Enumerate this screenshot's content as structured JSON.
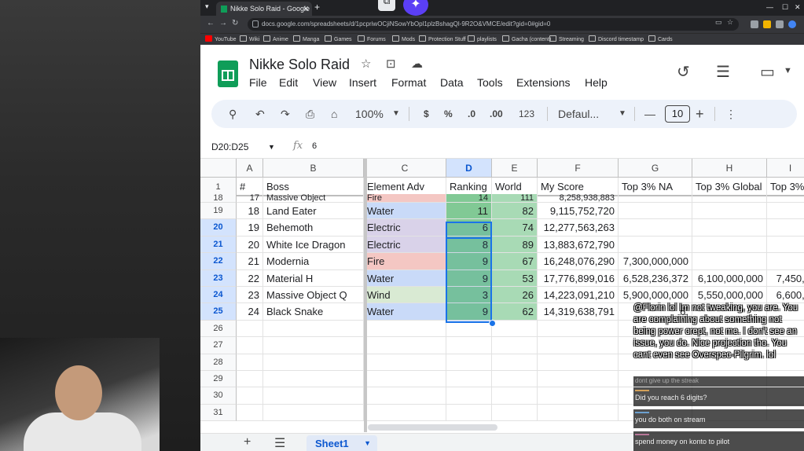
{
  "browser": {
    "tab_title": "Nikke Solo Raid - Google Sheets",
    "url": "docs.google.com/spreadsheets/d/1pcpriwOCjiNSowYbOpl1plzBshagQl-9R2O&VMCE/edit?gid=0#gid=0",
    "bookmarks": [
      "YouTube",
      "Wiki",
      "Anime",
      "Manga",
      "Games",
      "Forums",
      "Mods",
      "Protection Stuff",
      "playlists",
      "Gacha (content)",
      "Streaming",
      "Discord timestamp",
      "Cards"
    ]
  },
  "sheets": {
    "title": "Nikke Solo Raid",
    "menu": [
      "File",
      "Edit",
      "View",
      "Insert",
      "Format",
      "Data",
      "Tools",
      "Extensions",
      "Help"
    ],
    "toolbar": {
      "zoom": "100%",
      "currency": "$",
      "percent": "%",
      "dec_decrease": ".0",
      "dec_increase": ".00",
      "number_format": "123",
      "font": "Defaul...",
      "font_size": "10",
      "minus": "—",
      "plus": "+",
      "more": "⋮"
    },
    "name_box": "D20:D25",
    "fx": "fx",
    "formula_value": "6",
    "columns": [
      "A",
      "B",
      "C",
      "D",
      "E",
      "F",
      "G",
      "H",
      "I"
    ],
    "header_row": {
      "row": "1",
      "cells": [
        "#",
        "Boss",
        "Element Adv",
        "Ranking",
        "World",
        "My Score",
        "Top 3% NA",
        "Top 3% Global",
        "Top 3%"
      ]
    },
    "rows": [
      {
        "row": "18",
        "num": "17",
        "boss": "Massive Object",
        "element": "Fire",
        "ranking": "14",
        "world": "111",
        "score": "8,258,938,883",
        "na": "",
        "global": "",
        "top": ""
      },
      {
        "row": "19",
        "num": "18",
        "boss": "Land Eater",
        "element": "Water",
        "ranking": "11",
        "world": "82",
        "score": "9,115,752,720",
        "na": "",
        "global": "",
        "top": ""
      },
      {
        "row": "20",
        "num": "19",
        "boss": "Behemoth",
        "element": "Electric",
        "ranking": "6",
        "world": "74",
        "score": "12,277,563,263",
        "na": "",
        "global": "",
        "top": ""
      },
      {
        "row": "21",
        "num": "20",
        "boss": "White Ice Dragon",
        "element": "Electric",
        "ranking": "8",
        "world": "89",
        "score": "13,883,672,790",
        "na": "",
        "global": "",
        "top": ""
      },
      {
        "row": "22",
        "num": "21",
        "boss": "Modernia",
        "element": "Fire",
        "ranking": "9",
        "world": "67",
        "score": "16,248,076,290",
        "na": "7,300,000,000",
        "global": "",
        "top": ""
      },
      {
        "row": "23",
        "num": "22",
        "boss": "Material H",
        "element": "Water",
        "ranking": "9",
        "world": "53",
        "score": "17,776,899,016",
        "na": "6,528,236,372",
        "global": "6,100,000,000",
        "top": "7,450,0"
      },
      {
        "row": "24",
        "num": "23",
        "boss": "Massive Object Q",
        "element": "Wind",
        "ranking": "3",
        "world": "26",
        "score": "14,223,091,210",
        "na": "5,900,000,000",
        "global": "5,550,000,000",
        "top": "6,600,0"
      },
      {
        "row": "25",
        "num": "24",
        "boss": "Black Snake",
        "element": "Water",
        "ranking": "9",
        "world": "62",
        "score": "14,319,638,791",
        "na": "6,",
        "global": "",
        "top": ""
      },
      {
        "row": "26",
        "num": "",
        "boss": "",
        "element": "",
        "ranking": "",
        "world": "",
        "score": "",
        "na": "",
        "global": "",
        "top": ""
      },
      {
        "row": "27",
        "num": "",
        "boss": "",
        "element": "",
        "ranking": "",
        "world": "",
        "score": "",
        "na": "",
        "global": "",
        "top": ""
      },
      {
        "row": "28",
        "num": "",
        "boss": "",
        "element": "",
        "ranking": "",
        "world": "",
        "score": "",
        "na": "",
        "global": "",
        "top": ""
      },
      {
        "row": "29",
        "num": "",
        "boss": "",
        "element": "",
        "ranking": "",
        "world": "",
        "score": "",
        "na": "",
        "global": "",
        "top": ""
      },
      {
        "row": "30",
        "num": "",
        "boss": "",
        "element": "",
        "ranking": "",
        "world": "",
        "score": "",
        "na": "",
        "global": "",
        "top": ""
      },
      {
        "row": "31",
        "num": "",
        "boss": "",
        "element": "",
        "ranking": "",
        "world": "",
        "score": "",
        "na": "",
        "global": "",
        "top": ""
      }
    ],
    "sheet_tab": "Sheet1",
    "element_colors": {
      "Fire": "#f4c7c3",
      "Water": "#c9daf8",
      "Electric": "#d9d2e9",
      "Wind": "#d9ead3"
    },
    "ranking_color": "#81c995",
    "world_color": "#a8dab5"
  },
  "chat": {
    "main_message": "@Florin lol Im not tweaking, you are. You are complaining about something not being power crept, not me. I don't see an issue, you do. Nice projection tho. You cant even see Overspec-Pilgrim. lol",
    "main_tail": "dont give up the streak",
    "messages": [
      {
        "text": "Did you reach 6 digits?"
      },
      {
        "text": "you do both on stream"
      },
      {
        "text": "spend money on konto to pilot"
      }
    ]
  }
}
